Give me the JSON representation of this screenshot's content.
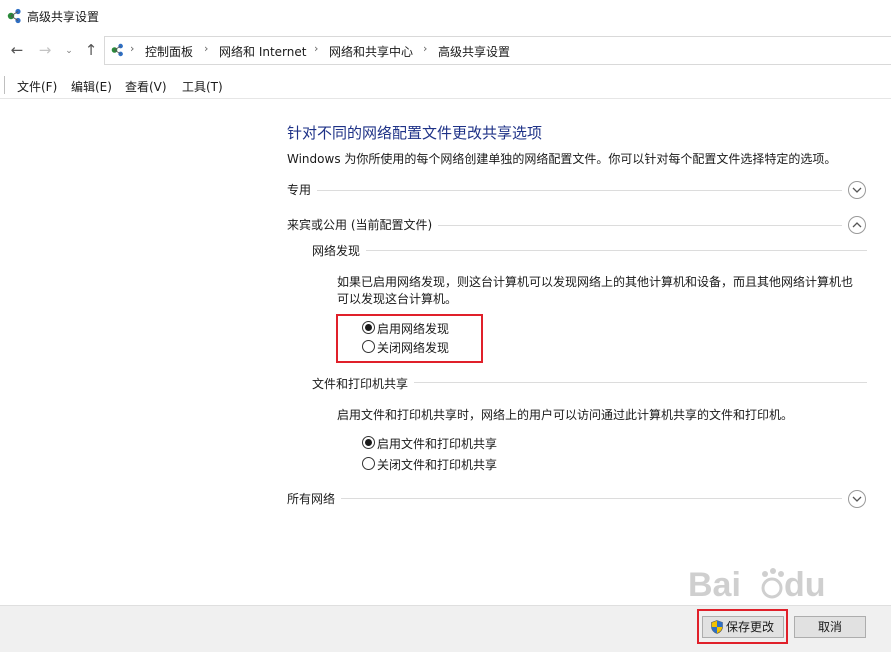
{
  "window": {
    "title": "高级共享设置"
  },
  "breadcrumbs": [
    "控制面板",
    "网络和 Internet",
    "网络和共享中心",
    "高级共享设置"
  ],
  "nav": {
    "back_icon": "arrow-left-icon",
    "forward_icon": "arrow-right-icon",
    "recent_icon": "chevron-down-icon",
    "up_icon": "arrow-up-icon"
  },
  "menu": [
    {
      "label": "文件(F)"
    },
    {
      "label": "编辑(E)"
    },
    {
      "label": "查看(V)"
    },
    {
      "label": "工具(T)"
    }
  ],
  "content": {
    "heading": "针对不同的网络配置文件更改共享选项",
    "description": "Windows 为你所使用的每个网络创建单独的网络配置文件。你可以针对每个配置文件选择特定的选项。",
    "sections": [
      {
        "label": "专用",
        "expanded": false
      },
      {
        "label": "来宾或公用 (当前配置文件)",
        "expanded": true,
        "subsections": [
          {
            "label": "网络发现",
            "description_line1": "如果已启用网络发现，则这台计算机可以发现网络上的其他计算机和设备，而且其他网络计算机也",
            "description_line2": "可以发现这台计算机。",
            "options": [
              {
                "label": "启用网络发现",
                "checked": true
              },
              {
                "label": "关闭网络发现",
                "checked": false
              }
            ]
          },
          {
            "label": "文件和打印机共享",
            "description": "启用文件和打印机共享时，网络上的用户可以访问通过此计算机共享的文件和打印机。",
            "options": [
              {
                "label": "启用文件和打印机共享",
                "checked": true
              },
              {
                "label": "关闭文件和打印机共享",
                "checked": false
              }
            ]
          }
        ]
      },
      {
        "label": "所有网络",
        "expanded": false
      }
    ]
  },
  "footer": {
    "save_label": "保存更改",
    "cancel_label": "取消"
  },
  "colors": {
    "heading": "#1e3287",
    "highlight": "#e0202a",
    "footer_bg": "#f0f0f0"
  }
}
